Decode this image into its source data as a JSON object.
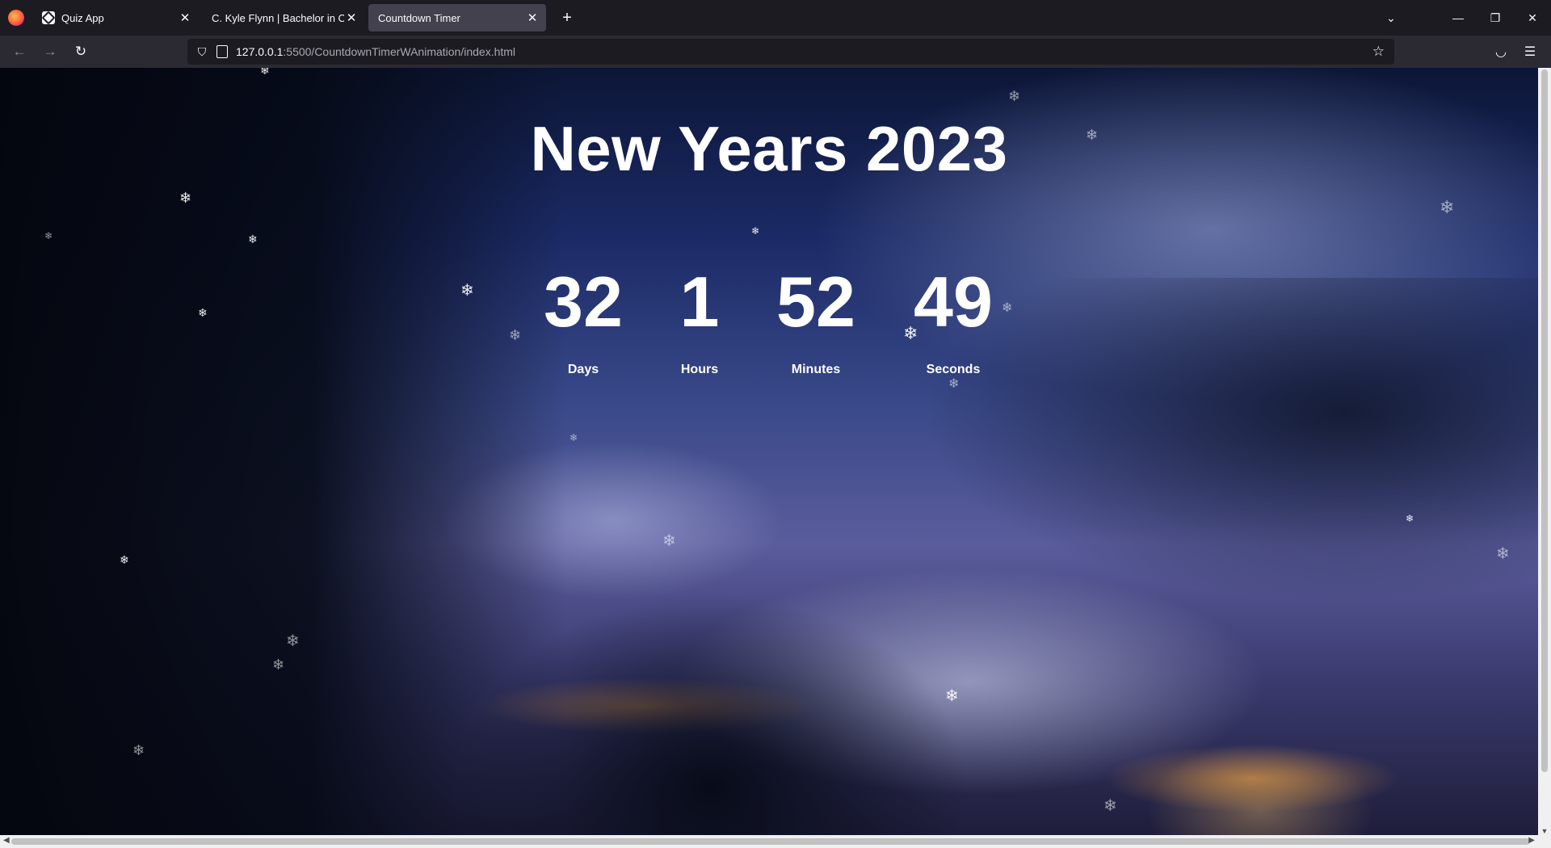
{
  "browser": {
    "tabs": [
      {
        "title": "Quiz App",
        "active": false
      },
      {
        "title": "C. Kyle Flynn | Bachelor in Compute",
        "active": false
      },
      {
        "title": "Countdown Timer",
        "active": true
      }
    ],
    "url_host": "127.0.0.1",
    "url_path": ":5500/CountdownTimerWAnimation/index.html"
  },
  "page": {
    "title": "New Years 2023",
    "countdown": [
      {
        "value": "32",
        "label": "Days"
      },
      {
        "value": "1",
        "label": "Hours"
      },
      {
        "value": "52",
        "label": "Minutes"
      },
      {
        "value": "49",
        "label": "Seconds"
      }
    ]
  },
  "icons": {
    "snowflake": "❄"
  }
}
